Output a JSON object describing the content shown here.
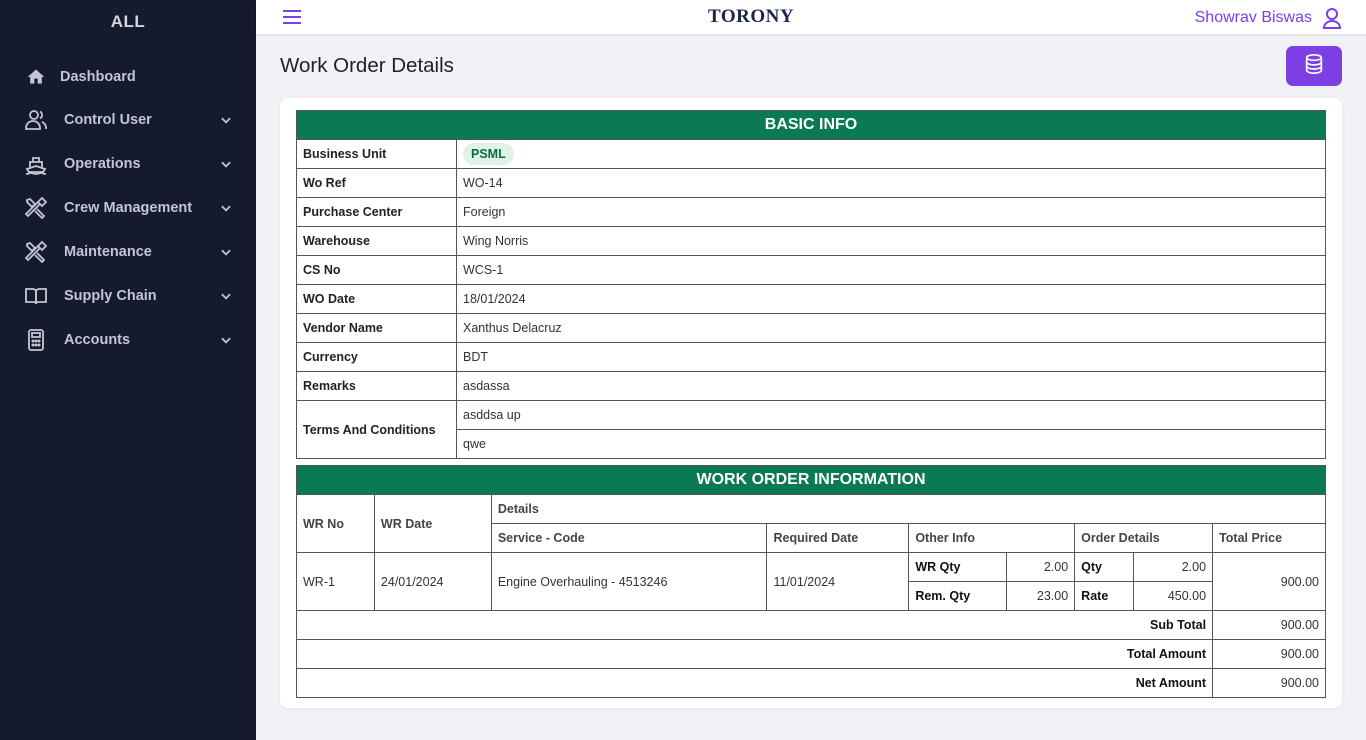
{
  "sidebar": {
    "brand": "ALL",
    "items": [
      {
        "label": "Dashboard",
        "icon": "home-icon"
      },
      {
        "label": "Control User",
        "icon": "users-icon"
      },
      {
        "label": "Operations",
        "icon": "ship-icon"
      },
      {
        "label": "Crew Management",
        "icon": "tools-icon"
      },
      {
        "label": "Maintenance",
        "icon": "tools-icon"
      },
      {
        "label": "Supply Chain",
        "icon": "book-icon"
      },
      {
        "label": "Accounts",
        "icon": "calculator-icon"
      }
    ]
  },
  "topbar": {
    "logo": "TORONY",
    "user_name": "Showrav Biswas"
  },
  "page": {
    "title": "Work Order Details"
  },
  "colors": {
    "sidebar_bg": "#161a2f",
    "accent": "#7b3fe4",
    "section_header": "#0a7a52"
  },
  "basic_info": {
    "heading": "BASIC INFO",
    "business_unit_label": "Business Unit",
    "business_unit": "PSML",
    "wo_ref_label": "Wo Ref",
    "wo_ref": "WO-14",
    "purchase_center_label": "Purchase Center",
    "purchase_center": "Foreign",
    "warehouse_label": "Warehouse",
    "warehouse": "Wing Norris",
    "cs_no_label": "CS No",
    "cs_no": "WCS-1",
    "wo_date_label": "WO Date",
    "wo_date": "18/01/2024",
    "vendor_name_label": "Vendor Name",
    "vendor_name": "Xanthus Delacruz",
    "currency_label": "Currency",
    "currency": "BDT",
    "remarks_label": "Remarks",
    "remarks": "asdassa",
    "terms_label": "Terms And Conditions",
    "terms": [
      "asddsa up",
      "qwe"
    ]
  },
  "work_order": {
    "heading": "WORK ORDER INFORMATION",
    "headers": {
      "wr_no": "WR No",
      "wr_date": "WR Date",
      "details": "Details",
      "service_code": "Service - Code",
      "required_date": "Required Date",
      "other_info": "Other Info",
      "order_details": "Order Details",
      "total_price": "Total Price"
    },
    "row": {
      "wr_no": "WR-1",
      "wr_date": "24/01/2024",
      "service_code": "Engine Overhauling - 4513246",
      "required_date": "11/01/2024",
      "wr_qty_label": "WR Qty",
      "wr_qty": "2.00",
      "rem_qty_label": "Rem. Qty",
      "rem_qty": "23.00",
      "qty_label": "Qty",
      "qty": "2.00",
      "rate_label": "Rate",
      "rate": "450.00",
      "total_price": "900.00"
    },
    "sub_total_label": "Sub Total",
    "sub_total": "900.00",
    "total_amount_label": "Total Amount",
    "total_amount": "900.00",
    "net_amount_label": "Net Amount",
    "net_amount": "900.00"
  }
}
